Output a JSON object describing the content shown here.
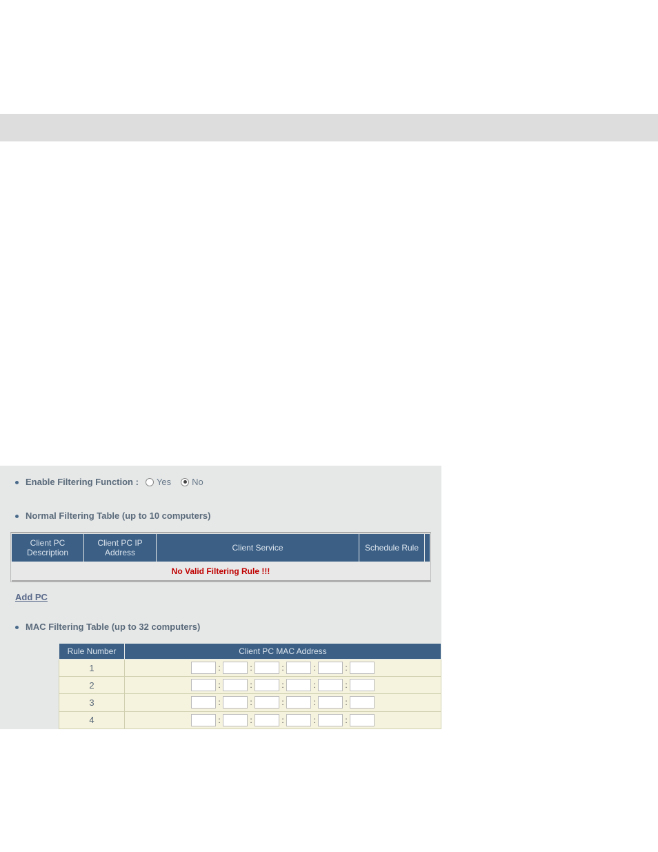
{
  "enable_filter": {
    "label": "Enable Filtering Function :",
    "yes": "Yes",
    "no": "No",
    "selected": "no"
  },
  "normal_table": {
    "title": "Normal Filtering Table (up to 10 computers)",
    "headers": {
      "desc": "Client PC Description",
      "ip": "Client PC IP Address",
      "service": "Client Service",
      "schedule": "Schedule Rule"
    },
    "no_rule": "No Valid Filtering Rule !!!"
  },
  "add_pc": "Add PC",
  "mac_table": {
    "title": "MAC Filtering Table (up to 32 computers)",
    "headers": {
      "rule": "Rule Number",
      "mac": "Client PC MAC Address"
    },
    "rows": [
      {
        "num": "1",
        "mac": [
          "",
          "",
          "",
          "",
          "",
          ""
        ]
      },
      {
        "num": "2",
        "mac": [
          "",
          "",
          "",
          "",
          "",
          ""
        ]
      },
      {
        "num": "3",
        "mac": [
          "",
          "",
          "",
          "",
          "",
          ""
        ]
      },
      {
        "num": "4",
        "mac": [
          "",
          "",
          "",
          "",
          "",
          ""
        ]
      }
    ],
    "sep": ":"
  }
}
